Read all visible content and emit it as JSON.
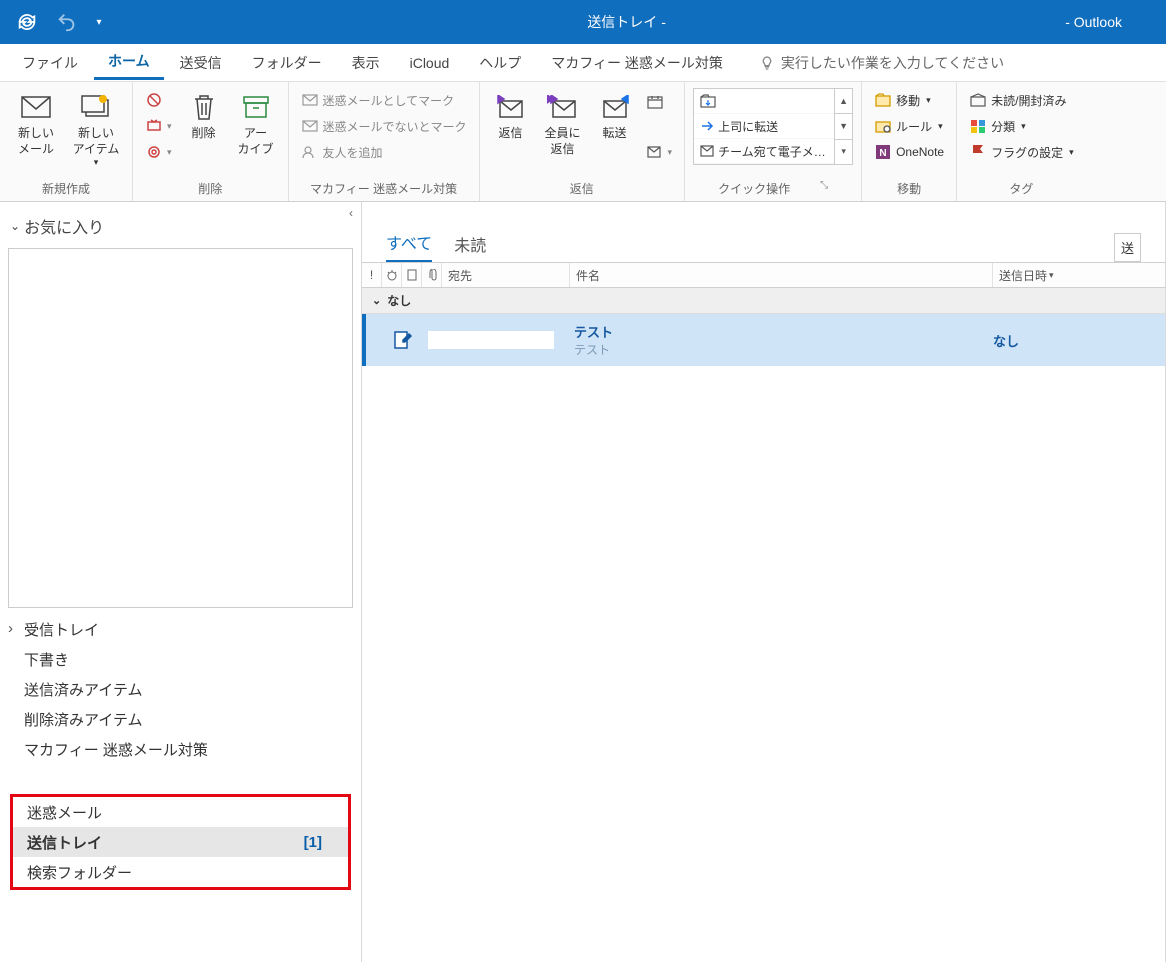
{
  "titlebar": {
    "center": "送信トレイ -",
    "right": "-  Outlook"
  },
  "tabs": {
    "file": "ファイル",
    "home": "ホーム",
    "sendreceive": "送受信",
    "folder": "フォルダー",
    "view": "表示",
    "icloud": "iCloud",
    "help": "ヘルプ",
    "mcafee": "マカフィー 迷惑メール対策",
    "tellme": "実行したい作業を入力してください"
  },
  "ribbon": {
    "new_group": "新規作成",
    "new_mail": "新しい\nメール",
    "new_items": "新しい\nアイテム",
    "delete_group": "削除",
    "delete_btn": "削除",
    "archive_btn": "アー\nカイブ",
    "mcafee_group": "マカフィー 迷惑メール対策",
    "mark_junk": "迷惑メールとしてマーク",
    "mark_not_junk": "迷惑メールでないとマーク",
    "add_friend": "友人を追加",
    "reply_group": "返信",
    "reply": "返信",
    "reply_all": "全員に\n返信",
    "forward": "転送",
    "quickstep_group": "クイック操作",
    "qs_fwd_boss": "上司に転送",
    "qs_team_mail": "チーム宛て電子メ…",
    "move_group": "移動",
    "move": "移動",
    "rules": "ルール",
    "onenote": "OneNote",
    "tag_group": "タグ",
    "unread": "未読/開封済み",
    "categorize": "分類",
    "flag": "フラグの設定"
  },
  "nav": {
    "favorites": "お気に入り",
    "inbox": "受信トレイ",
    "drafts": "下書き",
    "sent": "送信済みアイテム",
    "deleted": "削除済みアイテム",
    "mcafee_spam": "マカフィー 迷惑メール対策",
    "junk": "迷惑メール",
    "outbox": "送信トレイ",
    "outbox_count": "[1]",
    "search_folders": "検索フォルダー"
  },
  "maillist": {
    "filter_all": "すべて",
    "filter_unread": "未読",
    "send_label": "送",
    "col_to": "宛先",
    "col_subject": "件名",
    "col_sent": "送信日時",
    "group_none_header": "なし",
    "row1_subject": "テスト",
    "row1_preview": "テスト",
    "row1_date": "なし"
  }
}
